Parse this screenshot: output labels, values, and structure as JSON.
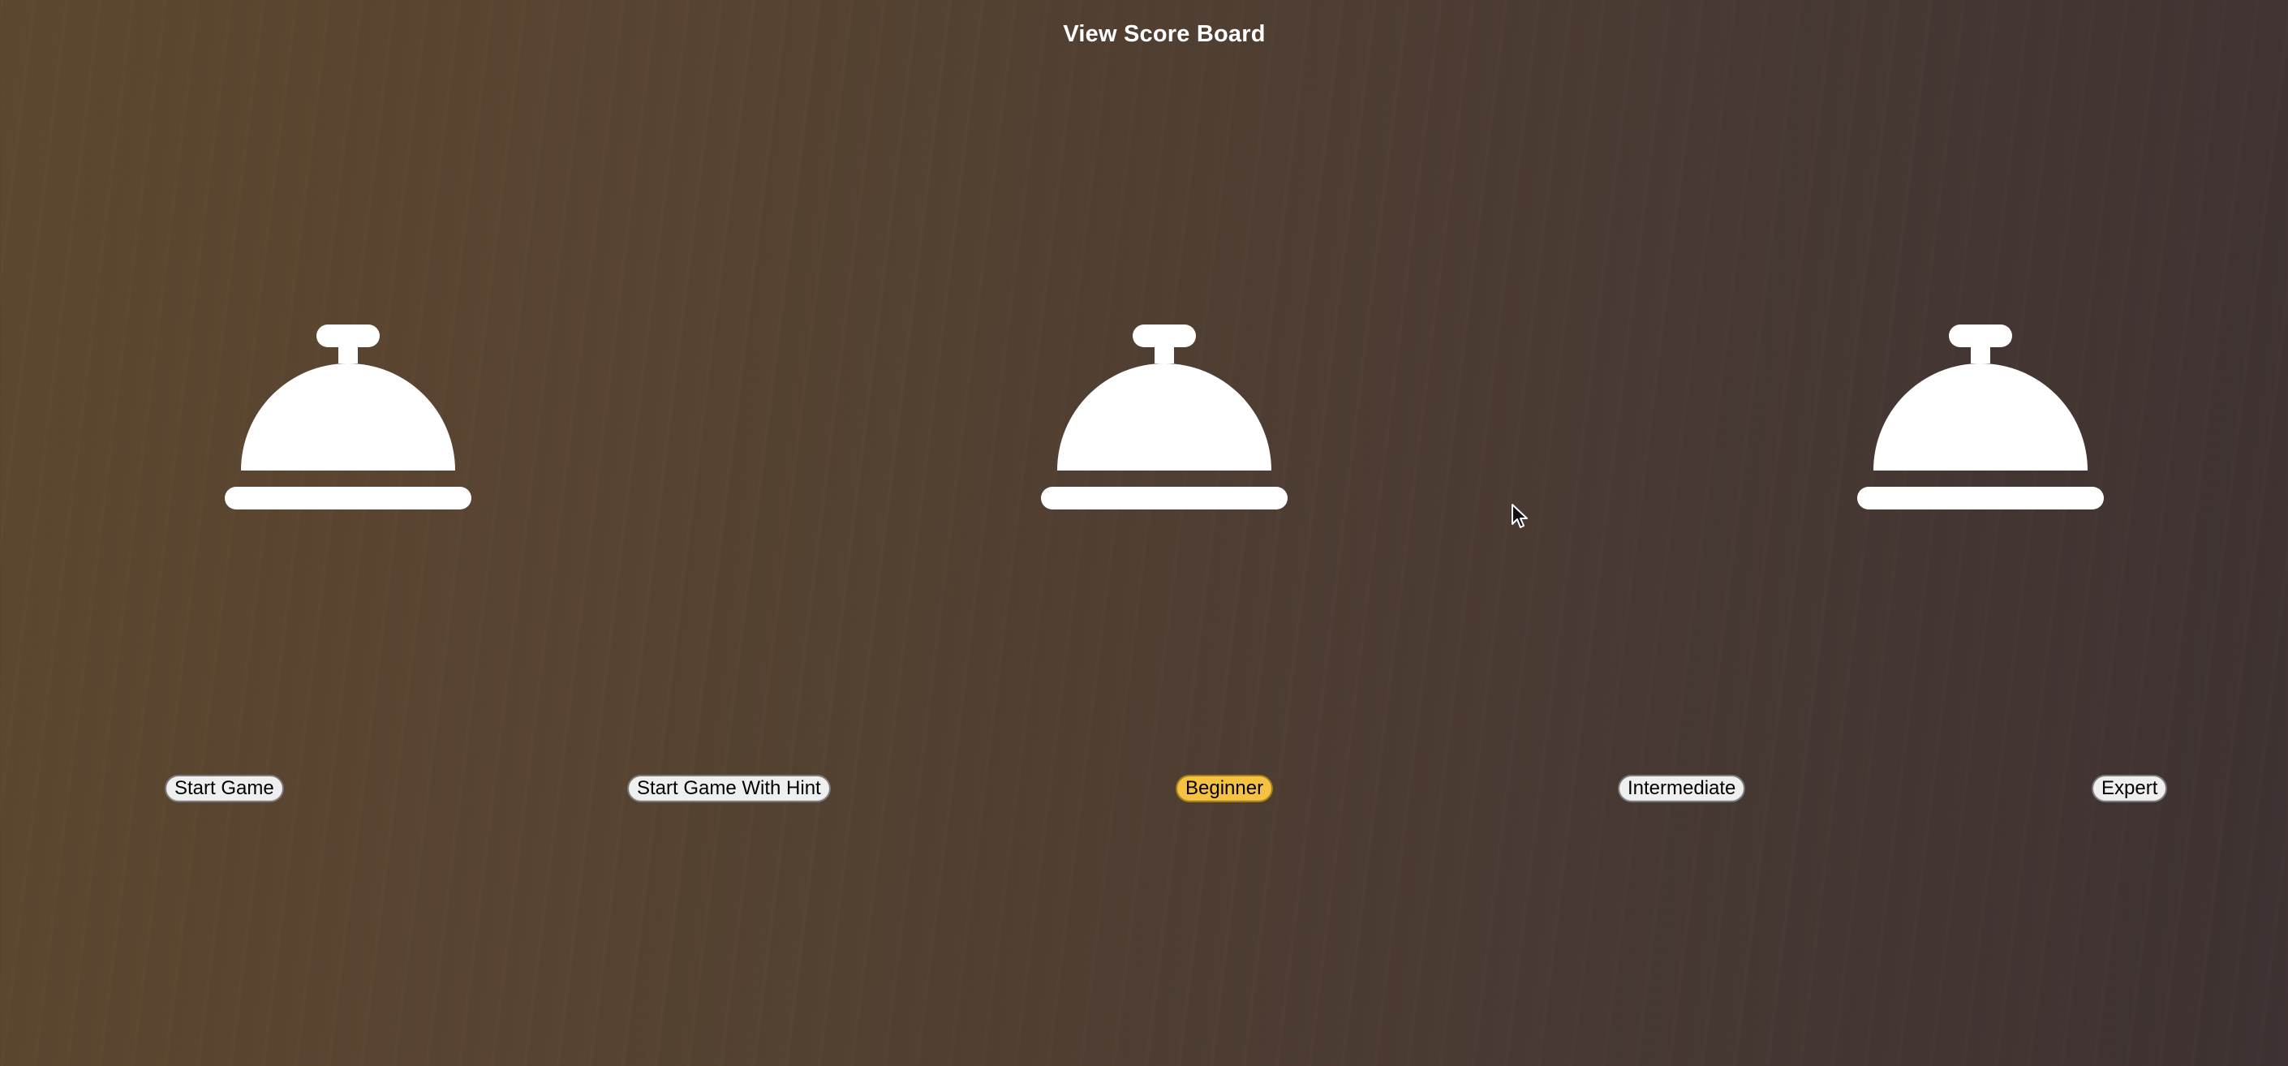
{
  "header": {
    "scoreboard_label": "View Score Board"
  },
  "bells": [
    {
      "icon": "bell-icon",
      "color": "#ffffff"
    },
    {
      "icon": "bell-icon",
      "color": "#ffffff"
    },
    {
      "icon": "bell-icon",
      "color": "#ffffff"
    }
  ],
  "controls": {
    "start_game_label": "Start Game",
    "start_game_hint_label": "Start Game With Hint"
  },
  "difficulty": {
    "options": [
      "Beginner",
      "Intermediate",
      "Expert"
    ],
    "selected": "Beginner",
    "selected_color": "#f5c242"
  },
  "theme": {
    "background_start": "#5e4730",
    "background_end": "#3e3232",
    "button_bg": "#efefef"
  }
}
